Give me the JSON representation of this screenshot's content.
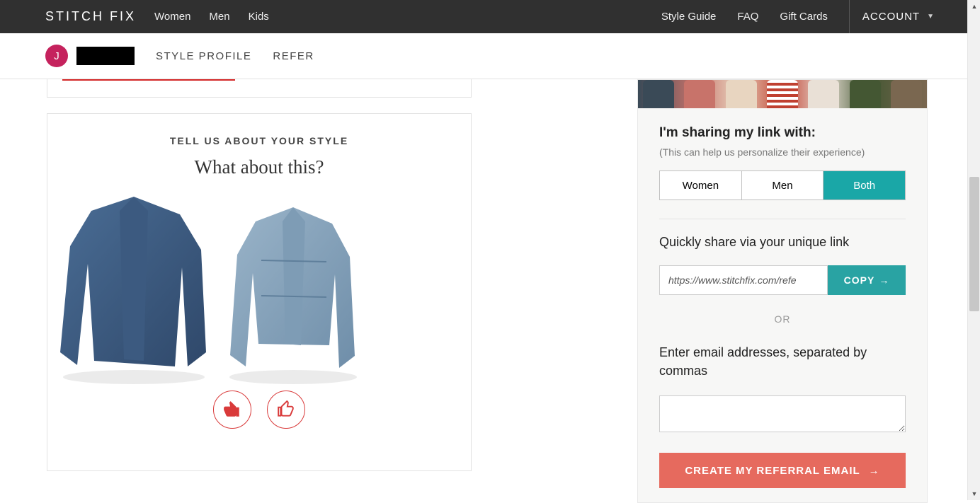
{
  "topnav": {
    "logo": "STITCH FIX",
    "left_links": [
      "Women",
      "Men",
      "Kids"
    ],
    "right_links": [
      "Style Guide",
      "FAQ",
      "Gift Cards"
    ],
    "account_label": "ACCOUNT"
  },
  "subnav": {
    "avatar_initial": "J",
    "links": [
      "STYLE PROFILE",
      "REFER"
    ]
  },
  "style_card": {
    "eyebrow": "TELL US ABOUT YOUR STYLE",
    "question": "What about this?"
  },
  "refer": {
    "share_with_heading": "I'm sharing my link with:",
    "share_with_sub": "(This can help us personalize their experience)",
    "segments": [
      "Women",
      "Men",
      "Both"
    ],
    "segment_active_index": 2,
    "quick_share_heading": "Quickly share via your unique link",
    "link_value": "https://www.stitchfix.com/refe",
    "copy_label": "COPY",
    "or_label": "OR",
    "email_label": "Enter email addresses, separated by commas",
    "create_label": "CREATE MY REFERRAL EMAIL"
  }
}
